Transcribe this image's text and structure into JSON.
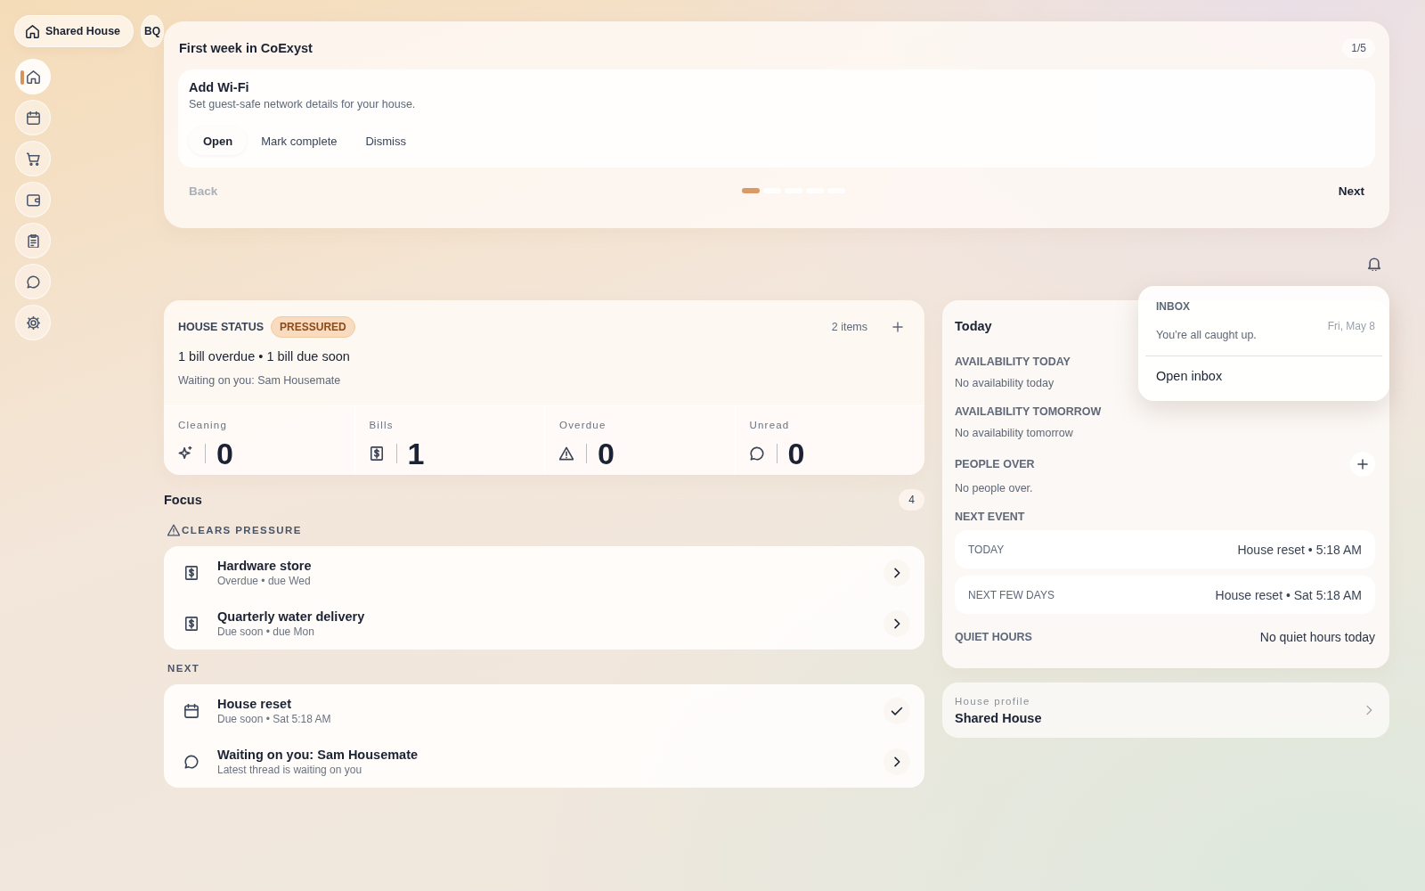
{
  "sidebar": {
    "house_button": "Shared House",
    "avatar": "BQ",
    "nav": [
      {
        "selected": true
      },
      {
        "selected": false
      },
      {
        "selected": false
      },
      {
        "selected": false
      },
      {
        "selected": false
      },
      {
        "selected": false
      },
      {
        "selected": false
      }
    ]
  },
  "onboarding": {
    "title": "First week in CoExyst",
    "progress": "1/5",
    "task": {
      "title": "Add Wi-Fi",
      "description": "Set guest-safe network details for your house.",
      "actions": [
        {
          "label": "Open",
          "kind": "primary"
        },
        {
          "label": "Mark complete",
          "kind": "plain"
        },
        {
          "label": "Dismiss",
          "kind": "plain"
        }
      ]
    },
    "back": {
      "label": "Back",
      "disabled": true
    },
    "next": {
      "label": "Next",
      "disabled": false
    },
    "steps": [
      {
        "selected": true
      },
      {
        "selected": false
      },
      {
        "selected": false
      },
      {
        "selected": false
      },
      {
        "selected": false
      }
    ]
  },
  "inbox": {
    "title": "INBOX",
    "message": "You’re all caught up.",
    "action": "Open inbox"
  },
  "house_status": {
    "title": "HOUSE STATUS",
    "badge": "PRESSURED",
    "count": "2 items",
    "summary": "1 bill overdue • 1 bill due soon",
    "waiting": "Waiting on you: Sam Housemate",
    "stats": [
      {
        "label": "Cleaning",
        "value": "0"
      },
      {
        "label": "Bills",
        "value": "1"
      },
      {
        "label": "Overdue",
        "value": "0"
      },
      {
        "label": "Unread",
        "value": "0"
      }
    ]
  },
  "focus": {
    "title": "Focus",
    "count": "4",
    "groups": [
      {
        "title": "CLEARS PRESSURE",
        "kind": "pressure",
        "items": [
          {
            "title": "Hardware store",
            "subtitle": "Overdue • due Wed",
            "kind": "bill",
            "done": false
          },
          {
            "title": "Quarterly water delivery",
            "subtitle": "Due soon • due Mon",
            "kind": "bill",
            "done": false
          }
        ]
      },
      {
        "title": "NEXT",
        "kind": "plain",
        "items": [
          {
            "title": "House reset",
            "subtitle": "Due soon • Sat 5:18 AM",
            "kind": "event",
            "done": true
          },
          {
            "title": "Waiting on you: Sam Housemate",
            "subtitle": "Latest thread is waiting on you",
            "kind": "thread",
            "done": false
          }
        ]
      }
    ]
  },
  "today": {
    "title": "Today",
    "date": "Fri, May 8",
    "availability": [
      {
        "label": "AVAILABILITY TODAY",
        "text": "No availability today"
      },
      {
        "label": "AVAILABILITY TOMORROW",
        "text": "No availability tomorrow"
      }
    ],
    "people_over": {
      "label": "PEOPLE OVER",
      "text": "No people over."
    },
    "next_event": {
      "label": "NEXT EVENT",
      "rows": [
        {
          "when": "TODAY",
          "event": "House reset • 5:18 AM"
        },
        {
          "when": "NEXT FEW DAYS",
          "event": "House reset • Sat 5:18 AM"
        }
      ]
    },
    "quiet_hours": {
      "label": "QUIET HOURS",
      "value": "No quiet hours today"
    }
  },
  "profile": {
    "label": "House profile",
    "name": "Shared House"
  }
}
